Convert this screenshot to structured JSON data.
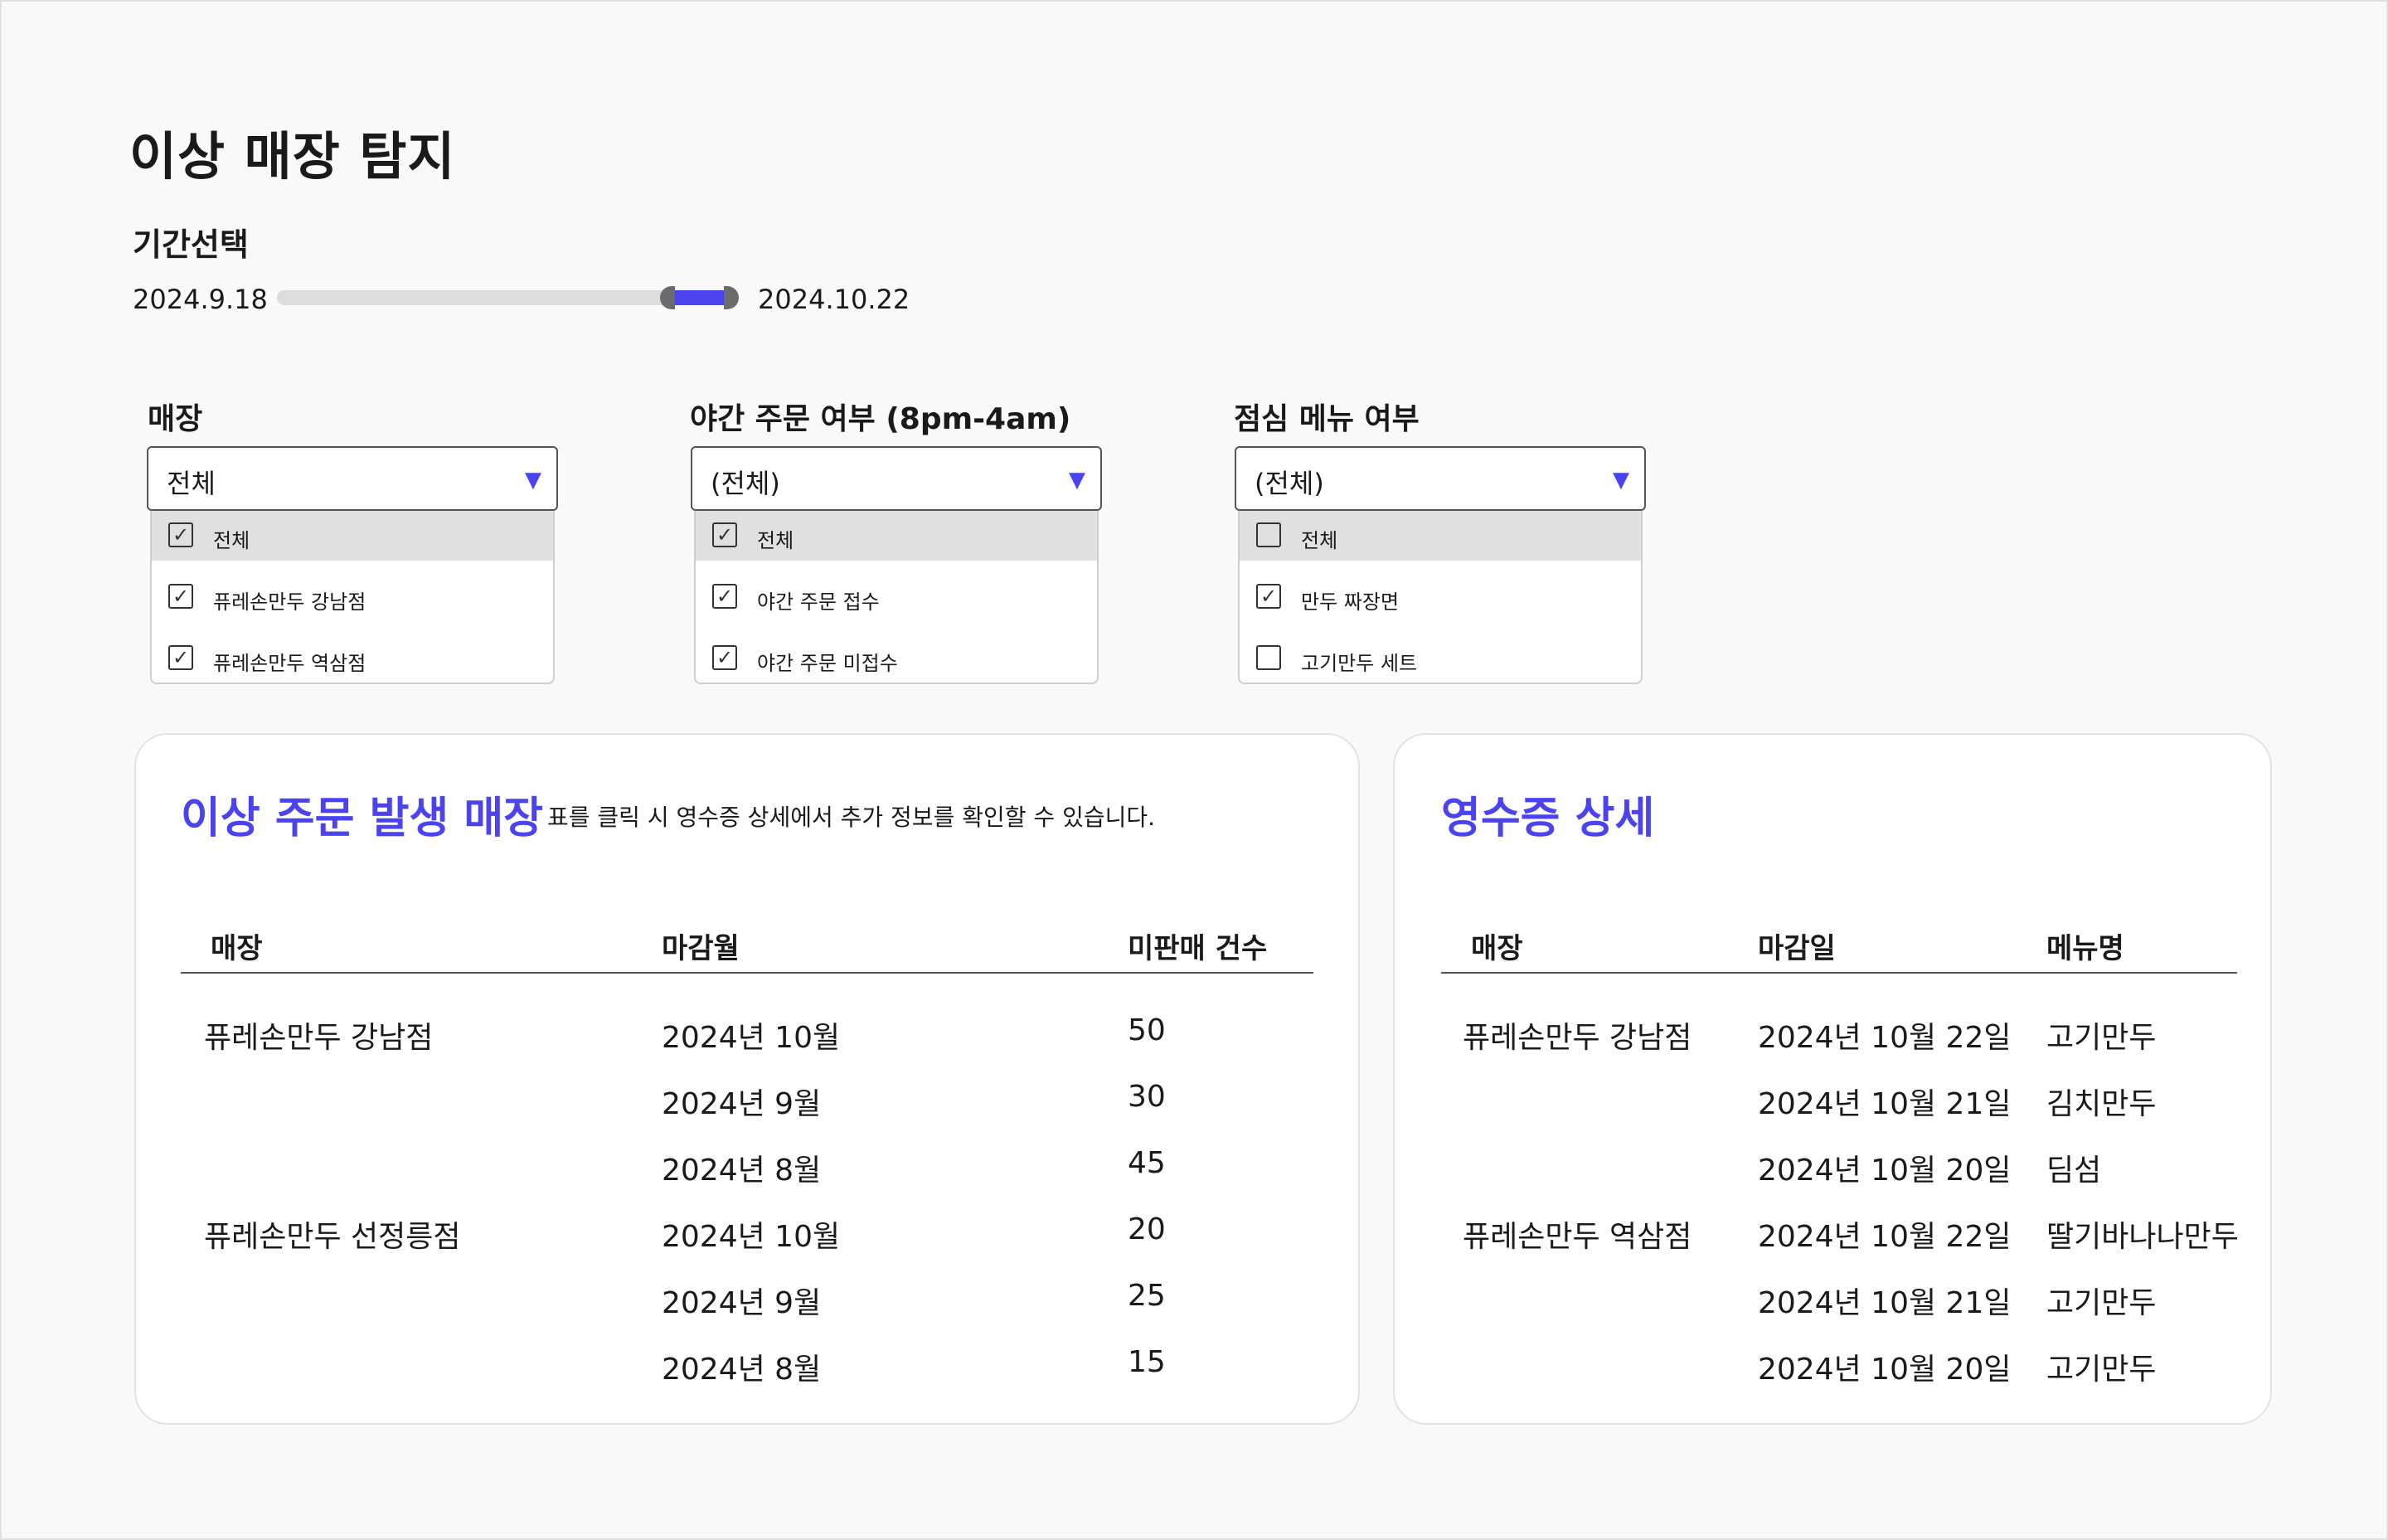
{
  "page_title": "이상 매장 탐지",
  "period": {
    "label": "기간선택",
    "start": "2024.9.18",
    "end": "2024.10.22"
  },
  "filters": [
    {
      "label": "매장",
      "selected": "전체",
      "options": [
        {
          "label": "전체",
          "checked": true
        },
        {
          "label": "퓨레손만두 강남점",
          "checked": true
        },
        {
          "label": "퓨레손만두 역삼점",
          "checked": true
        }
      ]
    },
    {
      "label": "야간 주문 여부 (8pm-4am)",
      "selected": "(전체)",
      "options": [
        {
          "label": "전체",
          "checked": true
        },
        {
          "label": "야간 주문 접수",
          "checked": true
        },
        {
          "label": "야간 주문 미접수",
          "checked": true
        }
      ]
    },
    {
      "label": "점심 메뉴 여부",
      "selected": "(전체)",
      "options": [
        {
          "label": "전체",
          "checked": false
        },
        {
          "label": "만두 짜장면",
          "checked": true
        },
        {
          "label": "고기만두 세트",
          "checked": false
        }
      ]
    }
  ],
  "anomaly_card": {
    "title": "이상 주문 발생 매장",
    "note": "표를 클릭 시 영수증 상세에서 추가 정보를 확인할 수 있습니다.",
    "headers": [
      "매장",
      "마감월",
      "미판매 건수"
    ],
    "rows": [
      [
        "퓨레손만두 강남점",
        "2024년 10월",
        "50"
      ],
      [
        "",
        "2024년 9월",
        "30"
      ],
      [
        "",
        "2024년 8월",
        "45"
      ],
      [
        "퓨레손만두 선정릉점",
        "2024년 10월",
        "20"
      ],
      [
        "",
        "2024년 9월",
        "25"
      ],
      [
        "",
        "2024년 8월",
        "15"
      ]
    ]
  },
  "receipt_card": {
    "title": "영수증 상세",
    "headers": [
      "매장",
      "마감일",
      "메뉴명"
    ],
    "rows": [
      [
        "퓨레손만두 강남점",
        "2024년 10월 22일",
        "고기만두"
      ],
      [
        "",
        "2024년 10월 21일",
        "김치만두"
      ],
      [
        "",
        "2024년 10월 20일",
        "딤섬"
      ],
      [
        "퓨레손만두 역삼점",
        "2024년 10월 22일",
        "딸기바나나만두"
      ],
      [
        "",
        "2024년 10월 21일",
        "고기만두"
      ],
      [
        "",
        "2024년 10월 20일",
        "고기만두"
      ]
    ]
  },
  "colors": {
    "accent": "#4b43f0",
    "background": "#f9f9f9"
  },
  "icons": {
    "dropdown": "triangle-down-icon",
    "check": "checkmark-icon"
  }
}
